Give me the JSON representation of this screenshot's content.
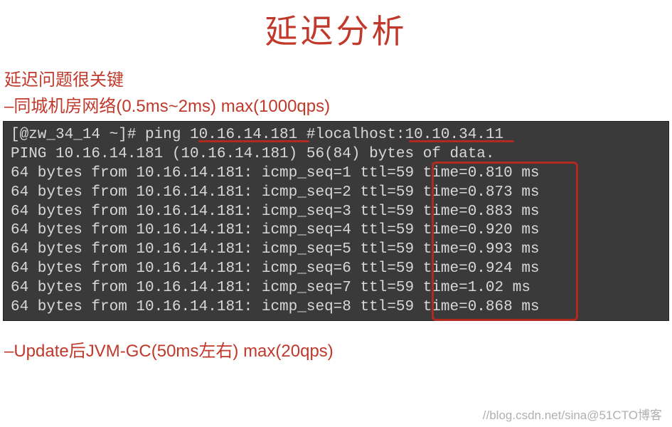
{
  "title": "延迟分析",
  "subtitle1": "延迟问题很关键",
  "subtitle2": "–同城机房网络(0.5ms~2ms)  max(1000qps)",
  "terminal": {
    "line1": "[@zw_34_14 ~]# ping 10.16.14.181 #localhost:10.10.34.11",
    "line2": "PING 10.16.14.181 (10.16.14.181) 56(84) bytes of data.",
    "ping_rows": [
      "64 bytes from 10.16.14.181: icmp_seq=1 ttl=59 time=0.810 ms",
      "64 bytes from 10.16.14.181: icmp_seq=2 ttl=59 time=0.873 ms",
      "64 bytes from 10.16.14.181: icmp_seq=3 ttl=59 time=0.883 ms",
      "64 bytes from 10.16.14.181: icmp_seq=4 ttl=59 time=0.920 ms",
      "64 bytes from 10.16.14.181: icmp_seq=5 ttl=59 time=0.993 ms",
      "64 bytes from 10.16.14.181: icmp_seq=6 ttl=59 time=0.924 ms",
      "64 bytes from 10.16.14.181: icmp_seq=7 ttl=59 time=1.02 ms",
      "64 bytes from 10.16.14.181: icmp_seq=8 ttl=59 time=0.868 ms"
    ]
  },
  "bottom_note": "–Update后JVM-GC(50ms左右)  max(20qps)",
  "watermark": "//blog.csdn.net/sina@51CTO博客"
}
